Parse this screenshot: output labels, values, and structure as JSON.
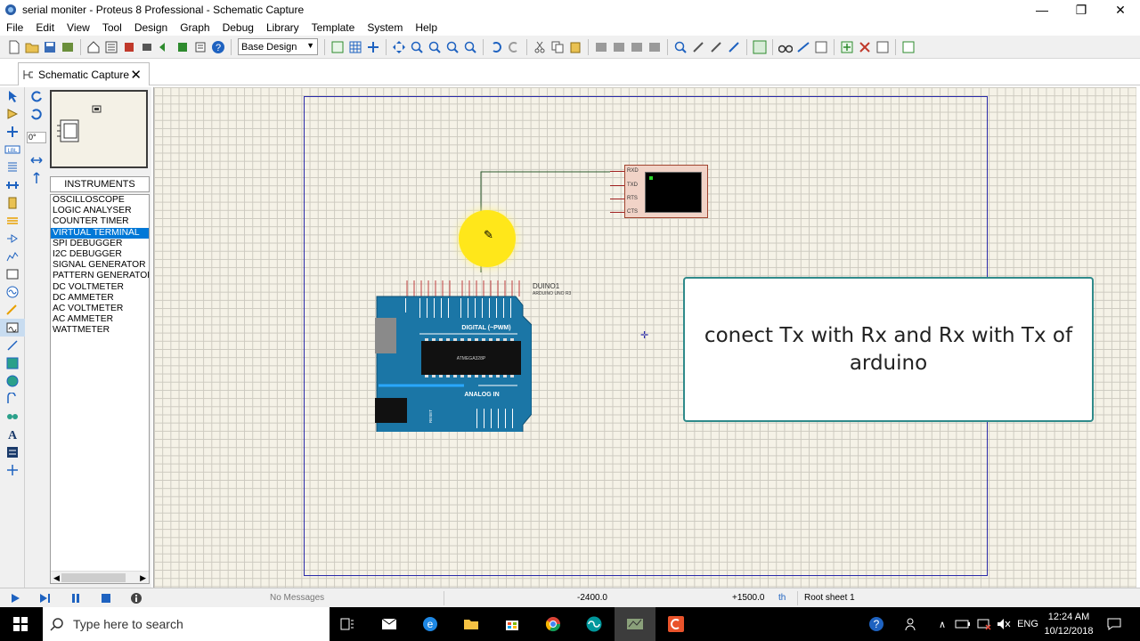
{
  "window": {
    "title": "serial moniter - Proteus 8 Professional - Schematic Capture",
    "minimize_glyph": "—",
    "maximize_glyph": "❐",
    "close_glyph": "✕"
  },
  "menu": [
    "File",
    "Edit",
    "View",
    "Tool",
    "Design",
    "Graph",
    "Debug",
    "Library",
    "Template",
    "System",
    "Help"
  ],
  "toolbar": {
    "design_select_value": "Base Design",
    "icons": [
      "new-file-icon",
      "open-folder-icon",
      "save-icon",
      "import-icon",
      "home-icon",
      "schematic-icon",
      "pcb-icon",
      "3d-icon",
      "gerber-icon",
      "bom-icon",
      "notes-icon",
      "help-icon",
      "refresh-icon",
      "grid-icon",
      "origin-icon",
      "pan-icon",
      "zoom-in-icon",
      "zoom-out-icon",
      "zoom-all-icon",
      "zoom-area-icon",
      "undo-icon",
      "redo-icon",
      "cut-icon",
      "copy-icon",
      "paste-icon",
      "block-copy-icon",
      "block-move-icon",
      "block-rotate-icon",
      "block-delete-icon",
      "pick-device-icon",
      "make-device-icon",
      "packaging-icon",
      "decompose-icon",
      "wire-autoroute-icon",
      "search-icon",
      "property-icon",
      "netlist-icon",
      "electrical-check-icon",
      "bill-icon"
    ]
  },
  "tab": {
    "label": "Schematic Capture",
    "close_glyph": "✕"
  },
  "side_panel": {
    "rotation_value": "0°",
    "section_title": "INSTRUMENTS",
    "selected_index": 3,
    "instruments": [
      "OSCILLOSCOPE",
      "LOGIC ANALYSER",
      "COUNTER TIMER",
      "VIRTUAL TERMINAL",
      "SPI DEBUGGER",
      "I2C DEBUGGER",
      "SIGNAL GENERATOR",
      "PATTERN GENERATOR",
      "DC VOLTMETER",
      "DC AMMETER",
      "AC VOLTMETER",
      "AC AMMETER",
      "WATTMETER"
    ]
  },
  "schematic": {
    "terminal_pins": [
      "RXD",
      "TXD",
      "RTS",
      "CTS"
    ],
    "arduino": {
      "ref": "DUINO1",
      "part": "ARDUINO UNO R3",
      "digital_label": "DIGITAL (~PWM)",
      "analog_label": "ANALOG IN",
      "chip_text": "ATMEGA328P",
      "reset_label": "RESET"
    },
    "callout_text": "conect Tx with Rx and Rx with Tx of arduino"
  },
  "status": {
    "message": "No Messages",
    "x_coord": "-2400.0",
    "y_coord": "+1500.0",
    "unit": "th",
    "sheet": "Root sheet 1"
  },
  "taskbar": {
    "search_placeholder": "Type here to search",
    "time": "12:24 AM",
    "date": "10/12/2018",
    "language": "ENG"
  },
  "colors": {
    "accent": "#0078d7",
    "canvas_bg": "#f5f2e7",
    "sheet_border": "#2a2aa8",
    "arduino_blue": "#1b76a6",
    "callout_border": "#2f8a8a"
  }
}
